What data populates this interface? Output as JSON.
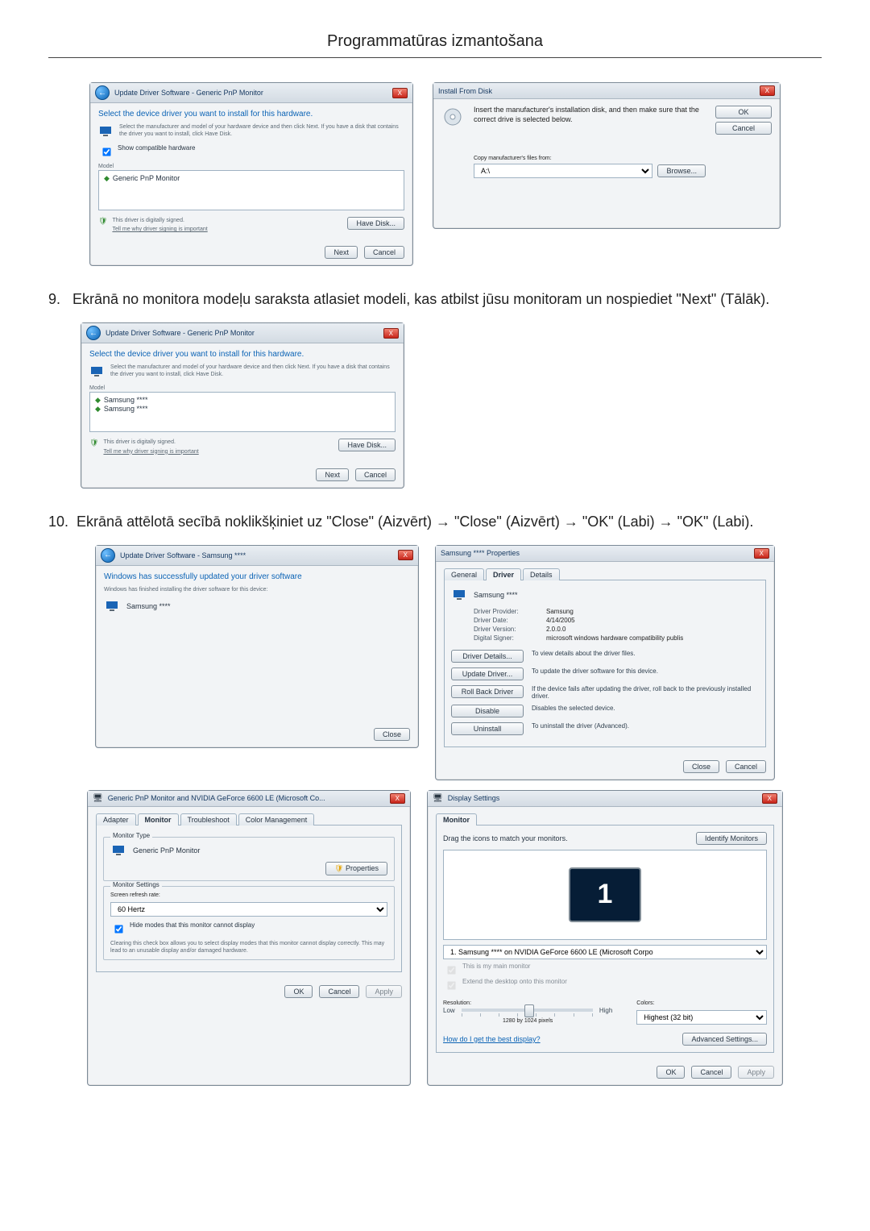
{
  "page": {
    "title": "Programmatūras izmantošana"
  },
  "step9": {
    "num": "9.",
    "text": "Ekrānā no monitora modeļu saraksta atlasiet modeli, kas atbilst jūsu monitoram un nospiediet \"Next\" (Tālāk)."
  },
  "step10": {
    "num": "10.",
    "text": "Ekrānā attēlotā secībā noklikšķiniet uz \"Close\" (Aizvērt) → \"Close\" (Aizvērt) → \"OK\" (Labi) → \"OK\" (Labi)."
  },
  "dlg_update1": {
    "crumb": "Update Driver Software - Generic PnP Monitor",
    "heading": "Select the device driver you want to install for this hardware.",
    "note": "Select the manufacturer and model of your hardware device and then click Next. If you have a disk that contains the driver you want to install, click Have Disk.",
    "show_compat": "Show compatible hardware",
    "model_label": "Model",
    "model_item": "Generic PnP Monitor",
    "signed": "This driver is digitally signed.",
    "signed_link": "Tell me why driver signing is important",
    "have_disk": "Have Disk...",
    "next": "Next",
    "cancel": "Cancel"
  },
  "dlg_installdisk": {
    "title": "Install From Disk",
    "note": "Insert the manufacturer's installation disk, and then make sure that the correct drive is selected below.",
    "ok": "OK",
    "cancel": "Cancel",
    "copy_label": "Copy manufacturer's files from:",
    "browse": "Browse..."
  },
  "dlg_update2": {
    "crumb": "Update Driver Software - Generic PnP Monitor",
    "heading": "Select the device driver you want to install for this hardware.",
    "note": "Select the manufacturer and model of your hardware device and then click Next. If you have a disk that contains the driver you want to install, click Have Disk.",
    "model_label": "Model",
    "model_item1": "Samsung ****",
    "model_item2": "Samsung ****",
    "signed": "This driver is digitally signed.",
    "signed_link": "Tell me why driver signing is important",
    "have_disk": "Have Disk...",
    "next": "Next",
    "cancel": "Cancel"
  },
  "dlg_update3": {
    "crumb": "Update Driver Software - Samsung ****",
    "heading": "Windows has successfully updated your driver software",
    "note": "Windows has finished installing the driver software for this device:",
    "device": "Samsung ****",
    "close": "Close"
  },
  "dlg_props": {
    "title": "Samsung **** Properties",
    "tab_general": "General",
    "tab_driver": "Driver",
    "tab_details": "Details",
    "device": "Samsung ****",
    "kv": {
      "provider_k": "Driver Provider:",
      "provider_v": "Samsung",
      "date_k": "Driver Date:",
      "date_v": "4/14/2005",
      "ver_k": "Driver Version:",
      "ver_v": "2.0.0.0",
      "signer_k": "Digital Signer:",
      "signer_v": "microsoft windows hardware compatibility publis"
    },
    "btns": {
      "details": "Driver Details...",
      "details_d": "To view details about the driver files.",
      "update": "Update Driver...",
      "update_d": "To update the driver software for this device.",
      "rollback": "Roll Back Driver",
      "rollback_d": "If the device fails after updating the driver, roll back to the previously installed driver.",
      "disable": "Disable",
      "disable_d": "Disables the selected device.",
      "uninstall": "Uninstall",
      "uninstall_d": "To uninstall the driver (Advanced)."
    },
    "close": "Close",
    "cancel": "Cancel"
  },
  "dlg_nvidia": {
    "title": "Generic PnP Monitor and NVIDIA GeForce 6600 LE (Microsoft Co...",
    "tab_adapter": "Adapter",
    "tab_monitor": "Monitor",
    "tab_ts": "Troubleshoot",
    "tab_cm": "Color Management",
    "grp_type": "Monitor Type",
    "type_val": "Generic PnP Monitor",
    "properties": "Properties",
    "grp_settings": "Monitor Settings",
    "refresh_label": "Screen refresh rate:",
    "refresh_val": "60 Hertz",
    "hide_modes": "Hide modes that this monitor cannot display",
    "hide_note": "Clearing this check box allows you to select display modes that this monitor cannot display correctly. This may lead to an unusable display and/or damaged hardware.",
    "ok": "OK",
    "cancel": "Cancel",
    "apply": "Apply"
  },
  "dlg_display": {
    "title": "Display Settings",
    "tab_monitor": "Monitor",
    "drag_label": "Drag the icons to match your monitors.",
    "identify": "Identify Monitors",
    "device_sel": "1. Samsung **** on NVIDIA GeForce 6600 LE (Microsoft Corpo",
    "chk_main": "This is my main monitor",
    "chk_extend": "Extend the desktop onto this monitor",
    "res_label": "Resolution:",
    "low": "Low",
    "high": "High",
    "res_val": "1280 by 1024 pixels",
    "colors_label": "Colors:",
    "colors_val": "Highest (32 bit)",
    "best_link": "How do I get the best display?",
    "adv": "Advanced Settings...",
    "ok": "OK",
    "cancel": "Cancel",
    "apply": "Apply"
  }
}
